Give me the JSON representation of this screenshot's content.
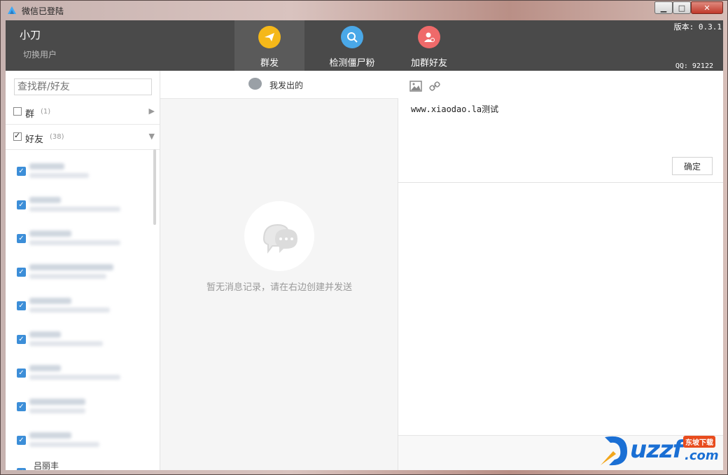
{
  "window": {
    "title": "微信已登陆"
  },
  "topbar": {
    "username": "小刀",
    "switch_user": "切换用户",
    "version": "版本: 0.3.1",
    "qq": "QQ: 92122",
    "nav": [
      {
        "label": "群发",
        "color": "#f5b819",
        "active": true
      },
      {
        "label": "检测僵尸粉",
        "color": "#4aa8e8",
        "active": false
      },
      {
        "label": "加群好友",
        "color": "#ef6a6a",
        "active": false
      }
    ]
  },
  "left": {
    "search_placeholder": "查找群/好友",
    "groups": {
      "label": "群",
      "count": "(1)"
    },
    "friends": {
      "label": "好友",
      "count": "(38)"
    },
    "last_name": "吕丽丰"
  },
  "middle": {
    "header": "我发出的",
    "empty": "暂无消息记录，请在右边创建并发送"
  },
  "right": {
    "message": "www.xiaodao.la测试",
    "confirm": "确定"
  },
  "watermark": {
    "text": "uzzf",
    "suffix": ".com",
    "tag": "东坡下载"
  }
}
